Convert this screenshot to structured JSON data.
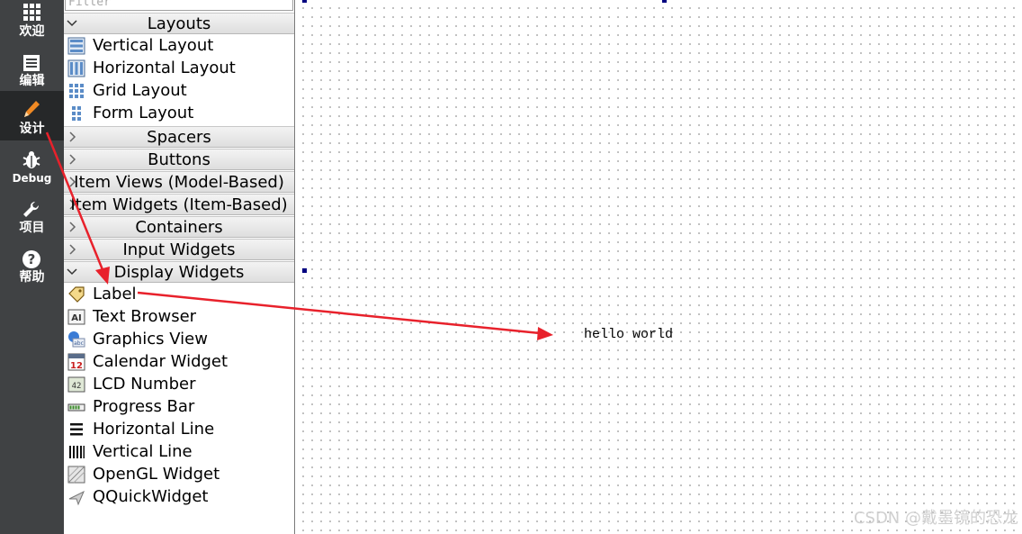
{
  "mode_bar": {
    "items": [
      {
        "label": "欢迎",
        "icon": "grid-icon"
      },
      {
        "label": "编辑",
        "icon": "document-icon"
      },
      {
        "label": "设计",
        "icon": "pencil-icon",
        "active": true
      },
      {
        "label": "Debug",
        "icon": "bug-icon"
      },
      {
        "label": "项目",
        "icon": "wrench-icon"
      },
      {
        "label": "帮助",
        "icon": "help-icon"
      }
    ]
  },
  "widget_box": {
    "filter_placeholder": "Filter",
    "categories": {
      "layouts": {
        "label": "Layouts",
        "expanded": true
      },
      "spacers": {
        "label": "Spacers",
        "expanded": false
      },
      "buttons": {
        "label": "Buttons",
        "expanded": false
      },
      "item_views": {
        "label": "Item Views (Model-Based)",
        "expanded": false
      },
      "item_widgets": {
        "label": "Item Widgets (Item-Based)",
        "expanded": false
      },
      "containers": {
        "label": "Containers",
        "expanded": false
      },
      "input_widgets": {
        "label": "Input Widgets",
        "expanded": false
      },
      "display_widgets": {
        "label": "Display Widgets",
        "expanded": true
      }
    },
    "layout_items": [
      {
        "label": "Vertical Layout",
        "icon": "vertical-layout-icon"
      },
      {
        "label": "Horizontal Layout",
        "icon": "horizontal-layout-icon"
      },
      {
        "label": "Grid Layout",
        "icon": "grid-layout-icon"
      },
      {
        "label": "Form Layout",
        "icon": "form-layout-icon"
      }
    ],
    "display_items": [
      {
        "label": "Label",
        "icon": "label-tag-icon"
      },
      {
        "label": "Text Browser",
        "icon": "text-browser-icon"
      },
      {
        "label": "Graphics View",
        "icon": "graphics-view-icon"
      },
      {
        "label": "Calendar Widget",
        "icon": "calendar-icon",
        "icon_text": "12"
      },
      {
        "label": "LCD Number",
        "icon": "lcd-number-icon",
        "icon_text": "42"
      },
      {
        "label": "Progress Bar",
        "icon": "progress-bar-icon"
      },
      {
        "label": "Horizontal Line",
        "icon": "horizontal-line-icon"
      },
      {
        "label": "Vertical Line",
        "icon": "vertical-line-icon"
      },
      {
        "label": "OpenGL Widget",
        "icon": "opengl-widget-icon"
      },
      {
        "label": "QQuickWidget",
        "icon": "qquickwidget-icon"
      }
    ]
  },
  "canvas": {
    "label_text": "hello world",
    "watermark": "CSDN @戴墨镜的恐龙"
  },
  "annotation": {
    "arrow_color": "#e8212b"
  }
}
